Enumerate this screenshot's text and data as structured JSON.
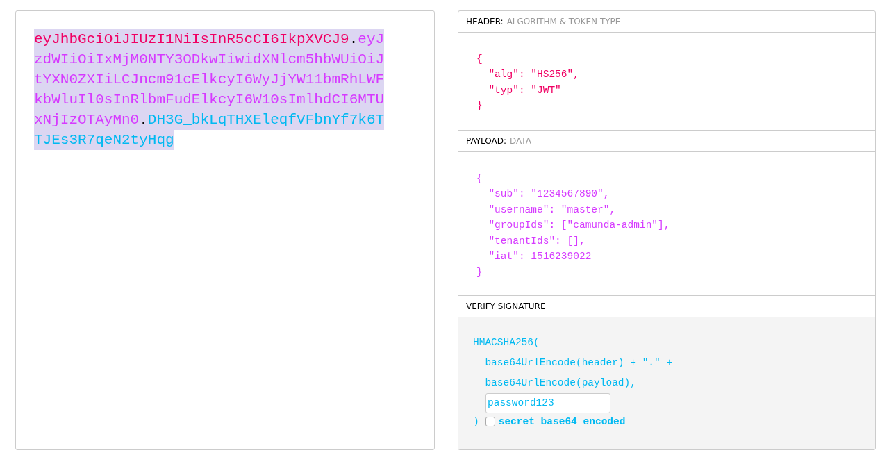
{
  "encoded": {
    "lines": [
      [
        {
          "text": "eyJhbGciOiJIUzI1NiIsInR5cCI6IkpXVCJ9",
          "color": "#f00063"
        },
        {
          "text": ".",
          "color": "#000000"
        },
        {
          "text": "eyJ",
          "color": "#d63aff"
        }
      ],
      [
        {
          "text": "zdWIiOiIxMjM0NTY3ODkwIiwidXNlcm5hbWUiOiJ",
          "color": "#d63aff"
        }
      ],
      [
        {
          "text": "tYXN0ZXIiLCJncm91cElkcyI6WyJjYW11bmRhLWF",
          "color": "#d63aff"
        }
      ],
      [
        {
          "text": "kbWluIl0sInRlbmFudElkcyI6W10sImlhdCI6MTU",
          "color": "#d63aff"
        }
      ],
      [
        {
          "text": "xNjIzOTAyMn0",
          "color": "#d63aff"
        },
        {
          "text": ".",
          "color": "#000000"
        },
        {
          "text": "DH3G_bkLqTHXEleqfVFbnYf7k6T",
          "color": "#00b9f1"
        }
      ],
      [
        {
          "text": "TJEs3R7qeN2tyHqg",
          "color": "#00b9f1"
        }
      ]
    ]
  },
  "header": {
    "title": "HEADER:",
    "subtitle": "ALGORITHM & TOKEN TYPE",
    "lines": [
      "{",
      "  \"alg\": \"HS256\",",
      "  \"typ\": \"JWT\"",
      "}"
    ]
  },
  "payload": {
    "title": "PAYLOAD:",
    "subtitle": "DATA",
    "lines": [
      "{",
      "  \"sub\": \"1234567890\",",
      "  \"username\": \"master\",",
      "  \"groupIds\": [\"camunda-admin\"],",
      "  \"tenantIds\": [],",
      "  \"iat\": 1516239022",
      "}"
    ]
  },
  "signature": {
    "title": "VERIFY SIGNATURE",
    "lines": [
      "HMACSHA256(",
      "  base64UrlEncode(header) + \".\" +",
      "  base64UrlEncode(payload),"
    ],
    "secret": "password123",
    "close": ")",
    "checkbox": {
      "label": "secret base64 encoded",
      "checked": false
    }
  }
}
